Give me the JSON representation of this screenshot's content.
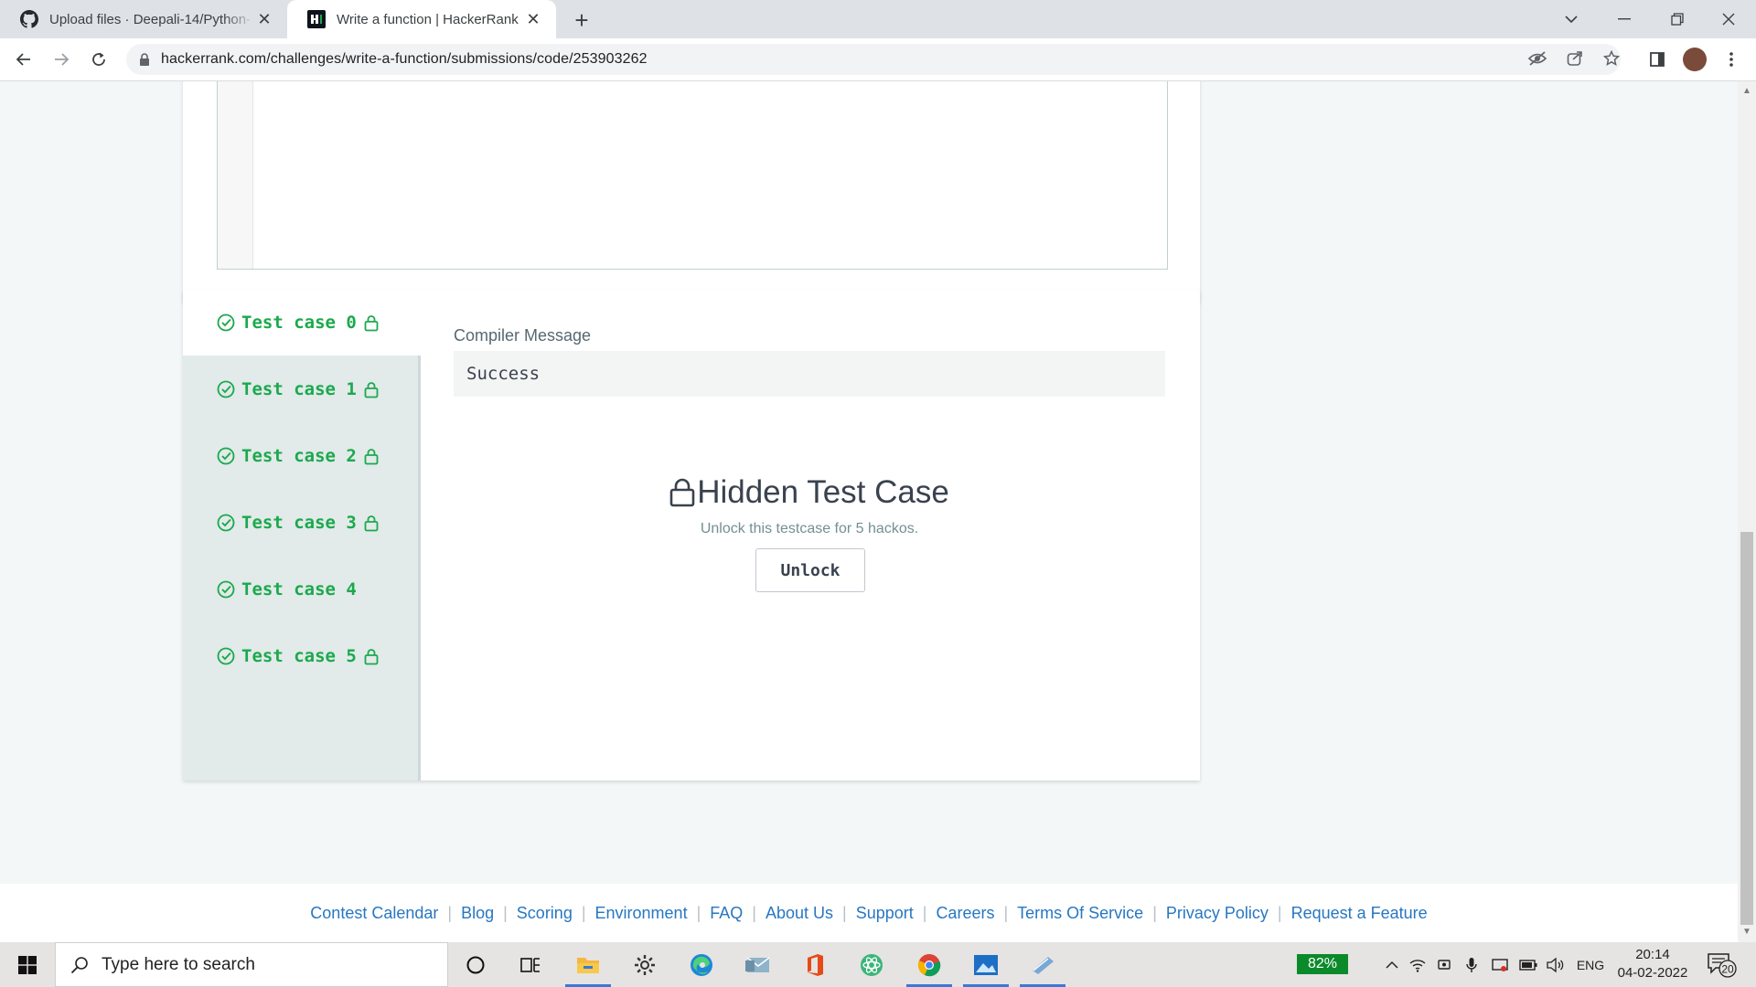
{
  "browser": {
    "tabs": [
      {
        "title": "Upload files · Deepali-14/Python-"
      },
      {
        "title": "Write a function | HackerRank"
      }
    ],
    "url": "hackerrank.com/challenges/write-a-function/submissions/code/253903262"
  },
  "test_cases": {
    "items": [
      {
        "label": "Test case 0",
        "locked": true
      },
      {
        "label": "Test case 1",
        "locked": true
      },
      {
        "label": "Test case 2",
        "locked": true
      },
      {
        "label": "Test case 3",
        "locked": true
      },
      {
        "label": "Test case 4",
        "locked": false
      },
      {
        "label": "Test case 5",
        "locked": true
      }
    ],
    "active_index": 0,
    "compiler_label": "Compiler Message",
    "compiler_message": "Success",
    "hidden_title": "Hidden Test Case",
    "hidden_subtitle": "Unlock this testcase for 5 hackos.",
    "unlock_label": "Unlock",
    "status_color": "#1ba94c"
  },
  "footer": {
    "links": [
      "Contest Calendar",
      "Blog",
      "Scoring",
      "Environment",
      "FAQ",
      "About Us",
      "Support",
      "Careers",
      "Terms Of Service",
      "Privacy Policy",
      "Request a Feature"
    ]
  },
  "taskbar": {
    "search_placeholder": "Type here to search",
    "battery": "82%",
    "language": "ENG",
    "time": "20:14",
    "date": "04-02-2022",
    "notifications": "20"
  }
}
